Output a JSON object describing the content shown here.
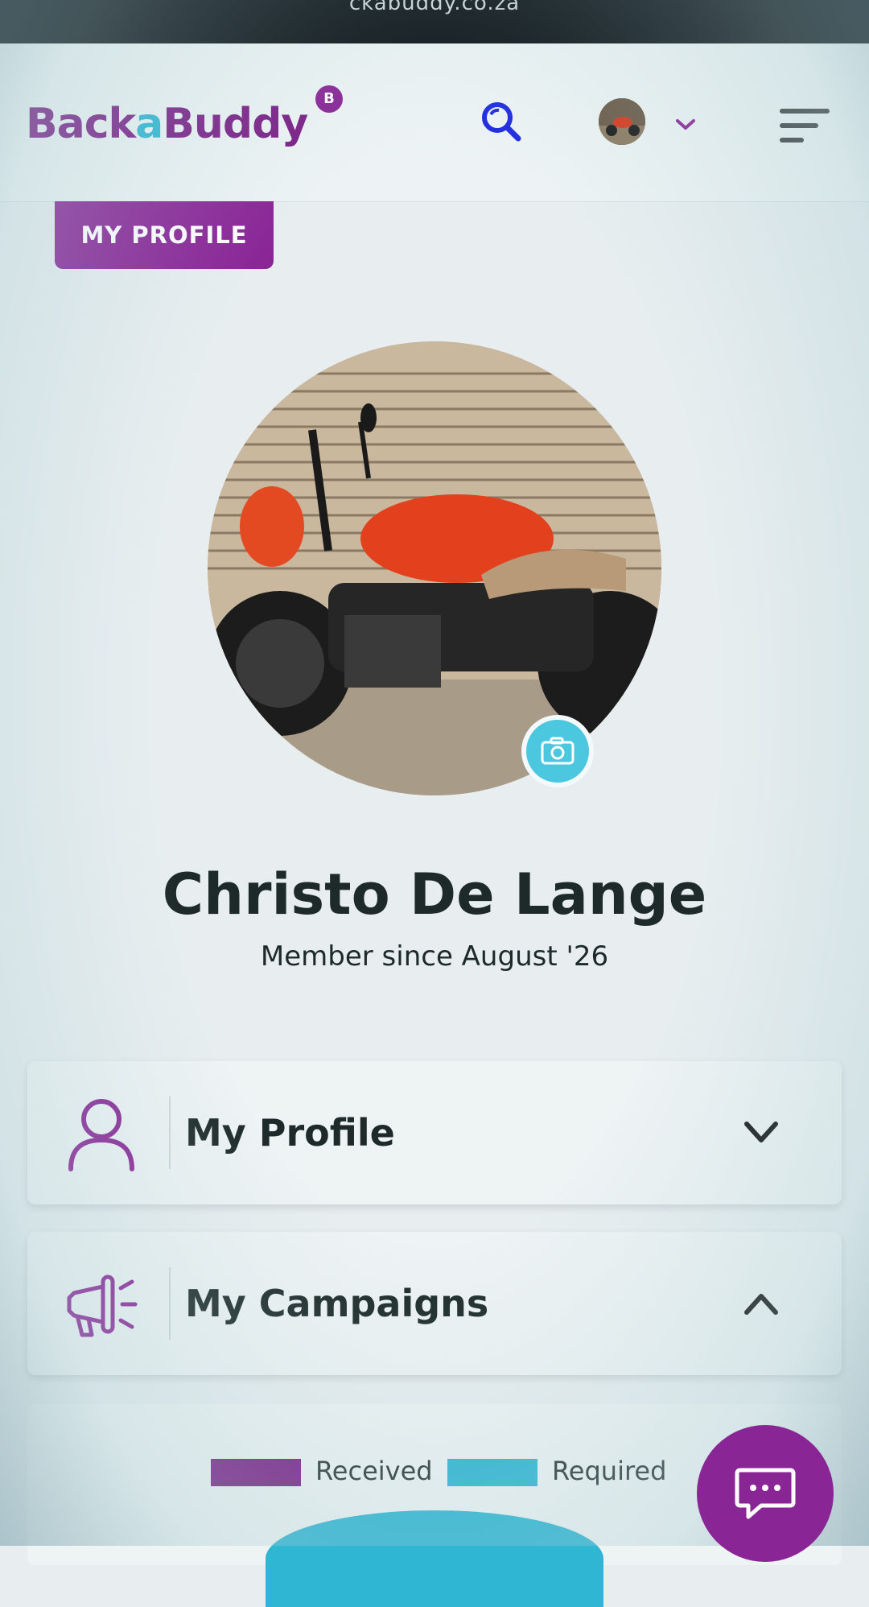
{
  "browser": {
    "url": "ckabuddy.co.za"
  },
  "header": {
    "logo": {
      "part1": "Back",
      "part2": "a",
      "part3": "Buddy"
    },
    "badge": "B"
  },
  "profile_tab": {
    "label": "MY PROFILE"
  },
  "profile": {
    "name": "Christo De Lange",
    "member_since": "Member since August '26"
  },
  "sections": [
    {
      "title": "My Profile",
      "icon": "user-icon",
      "expanded": false
    },
    {
      "title": "My Campaigns",
      "icon": "megaphone-icon",
      "expanded": true
    }
  ],
  "chart_legend": [
    {
      "label": "Received",
      "color": "#7a1e86"
    },
    {
      "label": "Required",
      "color": "#2fb6d3"
    }
  ],
  "colors": {
    "brand_purple": "#8a2596",
    "brand_cyan": "#2fb6d3"
  }
}
